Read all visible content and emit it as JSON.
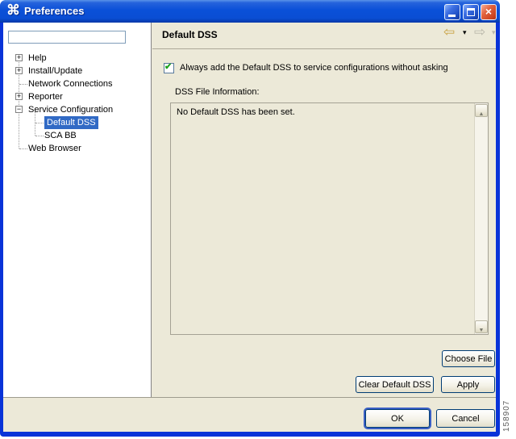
{
  "figure_number": "158907",
  "window": {
    "title": "Preferences"
  },
  "icons": {
    "window_icon_glyph": "⌘",
    "close_glyph": "×",
    "back_glyph": "⇦",
    "forward_glyph": "⇨",
    "dropdown_glyph": "▾",
    "check_glyph": "✔",
    "scroll_up_glyph": "▲",
    "scroll_down_glyph": "▼"
  },
  "sidebar": {
    "filter_value": "",
    "tree": [
      {
        "label": "Help",
        "expander": "+",
        "level": 0,
        "selected": false
      },
      {
        "label": "Install/Update",
        "expander": "+",
        "level": 0,
        "selected": false
      },
      {
        "label": "Network Connections",
        "expander": "",
        "level": 0,
        "selected": false
      },
      {
        "label": "Reporter",
        "expander": "+",
        "level": 0,
        "selected": false
      },
      {
        "label": "Service Configuration",
        "expander": "−",
        "level": 0,
        "selected": false
      },
      {
        "label": "Default DSS",
        "expander": "",
        "level": 1,
        "selected": true
      },
      {
        "label": "SCA BB",
        "expander": "",
        "level": 1,
        "selected": false
      },
      {
        "label": "Web Browser",
        "expander": "",
        "level": 0,
        "selected": false
      }
    ]
  },
  "main": {
    "title": "Default DSS",
    "checkbox": {
      "checked": true,
      "label": "Always add the Default DSS to service configurations without asking"
    },
    "dss_info_label": "DSS File Information:",
    "dss_info_text": "No Default DSS has been set.",
    "buttons": {
      "choose_file": "Choose File",
      "clear_default_dss": "Clear Default DSS",
      "apply": "Apply"
    }
  },
  "footer": {
    "ok": "OK",
    "cancel": "Cancel"
  },
  "colors": {
    "titlebar_blue": "#0A50D8",
    "window_border_blue": "#0933D8",
    "panel_beige": "#ECE9D8",
    "selection_blue": "#316AC5",
    "close_red": "#CC4420",
    "back_arrow_gold": "#C9A243"
  }
}
